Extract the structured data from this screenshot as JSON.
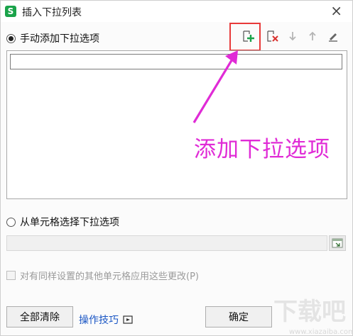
{
  "window": {
    "title": "插入下拉列表",
    "app_icon": "S",
    "close_glyph": "×"
  },
  "manual": {
    "label": "手动添加下拉选项",
    "selected": true
  },
  "toolbar": {
    "add_icon": "add-item-icon",
    "delete_icon": "delete-item-icon",
    "down_icon": "move-down-icon",
    "up_icon": "move-up-icon",
    "edit_icon": "edit-icon",
    "accent": "#1aa34a",
    "delete_color": "#d9322f"
  },
  "list": {
    "first_item_value": ""
  },
  "annotation": {
    "text": "添加下拉选项",
    "color": "#e02bd6"
  },
  "from_cells": {
    "label": "从单元格选择下拉选项",
    "selected": false
  },
  "apply_checkbox": {
    "label": "对有同样设置的其他单元格应用这些更改(P)",
    "checked": false,
    "enabled": false
  },
  "buttons": {
    "clear_all": "全部清除",
    "tips": "操作技巧",
    "ok": "确定"
  },
  "watermark": {
    "text": "下载吧",
    "url": "www.xiazaiba.com"
  }
}
